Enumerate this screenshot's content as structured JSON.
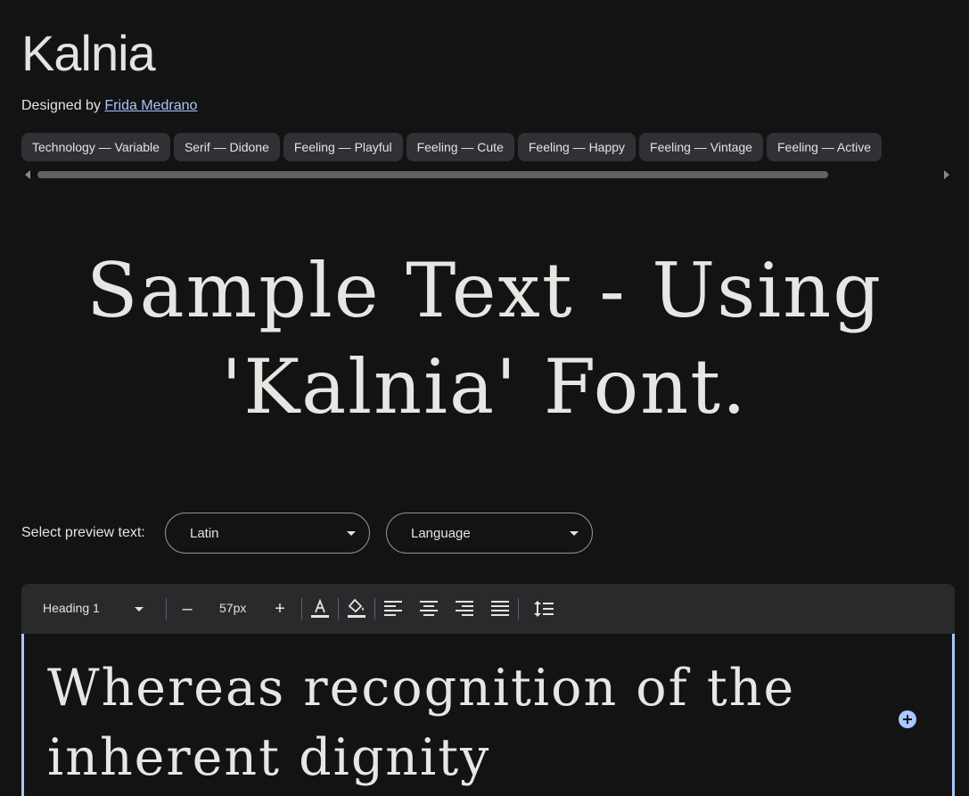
{
  "font": {
    "name": "Kalnia",
    "designed_by_prefix": "Designed by",
    "designer": "Frida Medrano"
  },
  "tags": [
    "Technology — Variable",
    "Serif — Didone",
    "Feeling — Playful",
    "Feeling — Cute",
    "Feeling — Happy",
    "Feeling — Vintage",
    "Feeling — Active"
  ],
  "hero": {
    "line1": "Sample Text - Using",
    "line2": "'Kalnia' Font."
  },
  "preview": {
    "label": "Select preview text:",
    "script_select": "Latin",
    "language_select": "Language"
  },
  "toolbar": {
    "style_select": "Heading 1",
    "decrease_label": "–",
    "font_size": "57px",
    "increase_label": "+",
    "icons": [
      "text-color-icon",
      "fill-color-icon",
      "align-left-icon",
      "align-center-icon",
      "align-right-icon",
      "align-justify-icon",
      "line-height-icon"
    ]
  },
  "editor": {
    "text": "Whereas recognition of the inherent dignity"
  },
  "colors": {
    "background": "#131314",
    "accent": "#a8c7fa",
    "chip": "#303134",
    "toolbar": "#282a2c"
  }
}
